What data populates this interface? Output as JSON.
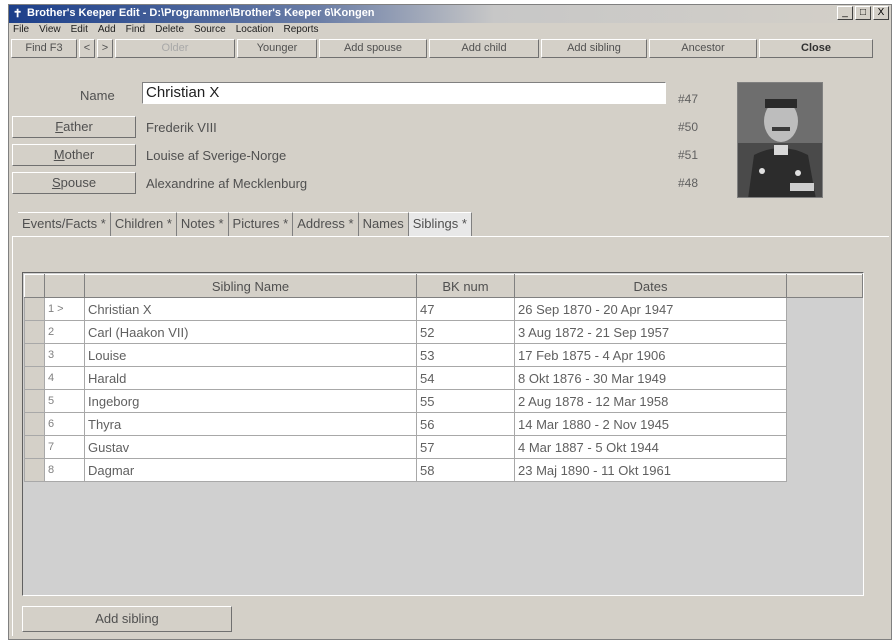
{
  "window": {
    "title": "Brother's Keeper Edit - D:\\Programmer\\Brother's Keeper 6\\Kongen",
    "controls": [
      "_",
      "□",
      "X"
    ]
  },
  "menu": [
    "File",
    "View",
    "Edit",
    "Add",
    "Find",
    "Delete",
    "Source",
    "Location",
    "Reports"
  ],
  "toolbar": {
    "find": "Find F3",
    "prev": "<",
    "next": ">",
    "older": "Older",
    "younger": "Younger",
    "add_spouse": "Add spouse",
    "add_child": "Add child",
    "add_sibling": "Add sibling",
    "ancestor": "Ancestor",
    "close": "Close"
  },
  "person": {
    "name_label": "Name",
    "name": "Christian X",
    "bk_num": "#47"
  },
  "relations": [
    {
      "label_first": "F",
      "label_rest": "ather",
      "name": "Frederik VIII",
      "bk": "#50"
    },
    {
      "label_first": "M",
      "label_rest": "other",
      "name": "Louise af Sverige-Norge",
      "bk": "#51"
    },
    {
      "label_first": "S",
      "label_rest": "pouse",
      "name": "Alexandrine af Mecklenburg",
      "bk": "#48"
    }
  ],
  "tabs": [
    "Events/Facts *",
    "Children *",
    "Notes *",
    "Pictures *",
    "Address *",
    "Names",
    "Siblings *"
  ],
  "siblings": {
    "headers": [
      "Sibling Name",
      "BK num",
      "Dates"
    ],
    "rows": [
      {
        "idx": "1 >",
        "name": "Christian X",
        "bk": "47",
        "dates": "26 Sep 1870 - 20 Apr 1947"
      },
      {
        "idx": "2",
        "name": "Carl (Haakon VII)",
        "bk": "52",
        "dates": "3 Aug 1872 - 21 Sep 1957"
      },
      {
        "idx": "3",
        "name": "Louise",
        "bk": "53",
        "dates": "17 Feb 1875 - 4 Apr 1906"
      },
      {
        "idx": "4",
        "name": "Harald",
        "bk": "54",
        "dates": "8 Okt 1876 - 30 Mar 1949"
      },
      {
        "idx": "5",
        "name": "Ingeborg",
        "bk": "55",
        "dates": "2 Aug 1878 - 12 Mar 1958"
      },
      {
        "idx": "6",
        "name": "Thyra",
        "bk": "56",
        "dates": "14 Mar 1880 - 2 Nov 1945"
      },
      {
        "idx": "7",
        "name": "Gustav",
        "bk": "57",
        "dates": "4 Mar 1887 - 5 Okt 1944"
      },
      {
        "idx": "8",
        "name": "Dagmar",
        "bk": "58",
        "dates": "23 Maj 1890 - 11 Okt 1961"
      }
    ]
  },
  "add_sibling_button": "Add sibling"
}
